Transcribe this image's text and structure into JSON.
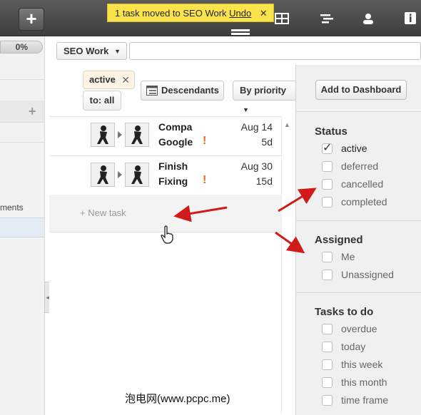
{
  "notification": {
    "text": "1 task moved to SEO Work",
    "undo": "Undo",
    "close": "✕"
  },
  "topbar": {
    "add_label": "+",
    "views": [
      "list-view-icon",
      "grid-view-icon",
      "gantt-view-icon",
      "user-view-icon",
      "info-icon"
    ]
  },
  "left": {
    "progress": "0%",
    "fragment": "ments",
    "progress_fraction": 0.0
  },
  "project_select": {
    "label": "SEO Work",
    "caret": "▼"
  },
  "filters": {
    "active_chip": "active",
    "chip_close": "✕",
    "to_chip": "to: all",
    "descendants": "Descendants",
    "sort": "By priority",
    "sort_caret": "▼"
  },
  "tasks": [
    {
      "title_line1": "Compa",
      "title_line2": "Google",
      "priority": "!",
      "date": "Aug 14",
      "duration": "5d"
    },
    {
      "title_line1": "Finish",
      "title_line2": "Fixing",
      "priority": "!",
      "date": "Aug 30",
      "duration": "15d"
    }
  ],
  "new_task": {
    "label": "New task",
    "plus": "+"
  },
  "right": {
    "add_to_dashboard": "Add to Dashboard",
    "status": {
      "title": "Status",
      "options": [
        {
          "label": "active",
          "checked": true
        },
        {
          "label": "deferred",
          "checked": false
        },
        {
          "label": "cancelled",
          "checked": false
        },
        {
          "label": "completed",
          "checked": false
        }
      ]
    },
    "assigned": {
      "title": "Assigned",
      "options": [
        {
          "label": "Me",
          "checked": false
        },
        {
          "label": "Unassigned",
          "checked": false
        }
      ]
    },
    "todo": {
      "title": "Tasks to do",
      "options": [
        {
          "label": "overdue",
          "checked": false
        },
        {
          "label": "today",
          "checked": false
        },
        {
          "label": "this week",
          "checked": false
        },
        {
          "label": "this month",
          "checked": false
        },
        {
          "label": "time frame",
          "checked": false
        }
      ]
    }
  },
  "watermark": "泡电网(www.pcpc.me)",
  "colors": {
    "notice_bg": "#fbe44b",
    "annotation_arrow": "#d11a1a",
    "priority": "#e8651a"
  }
}
